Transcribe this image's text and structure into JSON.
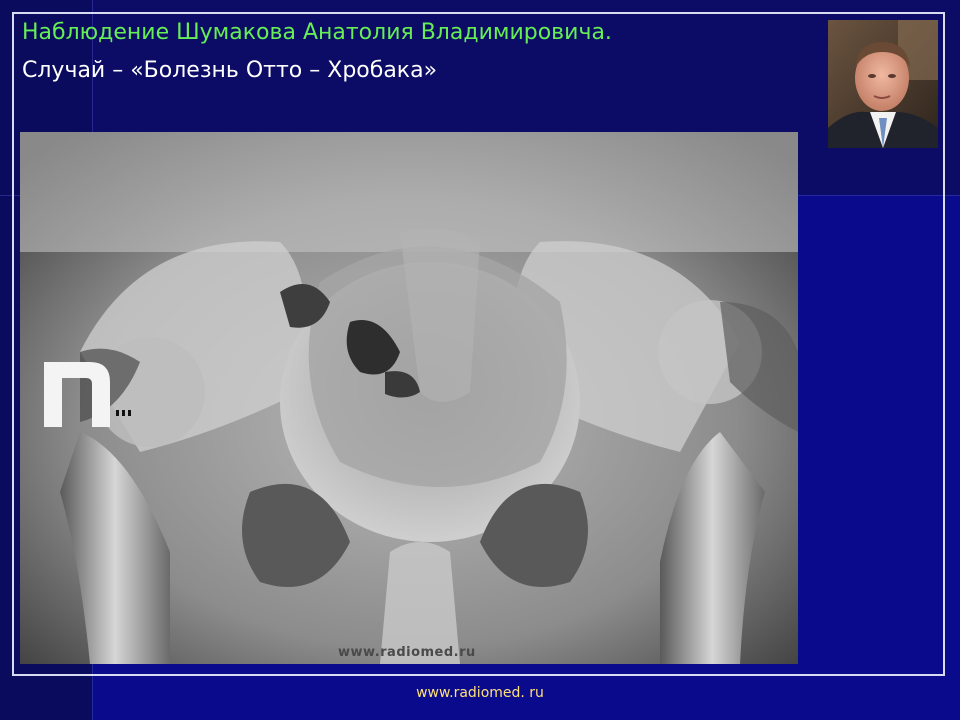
{
  "slide": {
    "title": "Наблюдение Шумакова Анатолия Владимировича.",
    "subtitle": "Случай – «Болезнь Отто – Хробака»",
    "watermark": "www.radiomed.ru",
    "footer": "www.radiomed. ru"
  },
  "images": {
    "portrait": "portrait-photo",
    "xray": "pelvis-xray"
  },
  "colors": {
    "background": "#0a0a8c",
    "title": "#66ee55",
    "subtitle": "#ffffff",
    "footer": "#ffe07a"
  }
}
